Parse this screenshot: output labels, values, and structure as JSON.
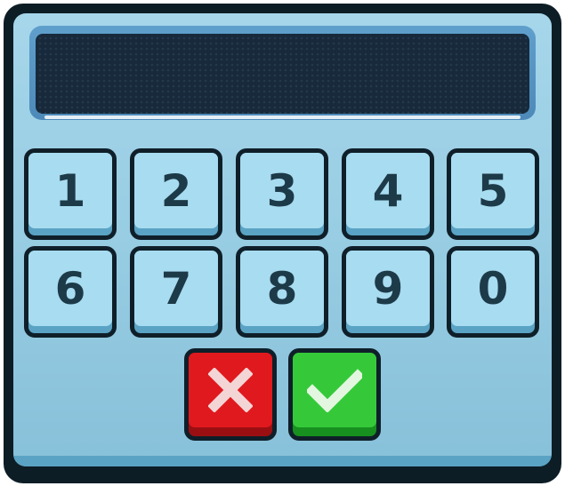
{
  "keypad": {
    "keys": [
      "1",
      "2",
      "3",
      "4",
      "5",
      "6",
      "7",
      "8",
      "9",
      "0"
    ],
    "cancel_icon": "x-icon",
    "confirm_icon": "checkmark-icon",
    "colors": {
      "body": "#a6d6ea",
      "key_face": "#a8dcf0",
      "screen": "#17293a",
      "cancel": "#e0191e",
      "confirm": "#35c93a"
    }
  }
}
